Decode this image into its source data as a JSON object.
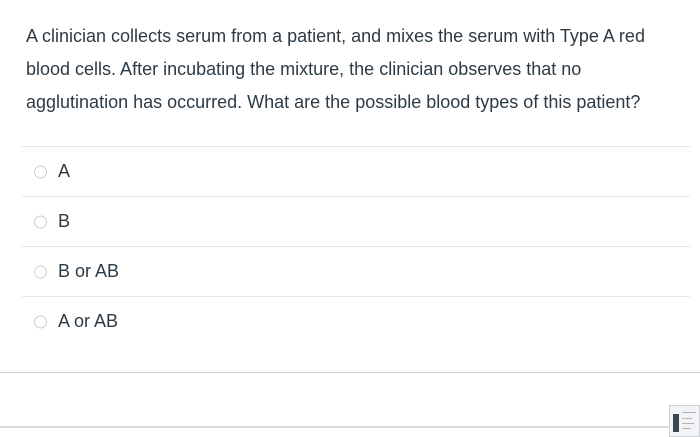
{
  "question": {
    "text": "A clinician collects serum from a patient, and mixes the serum with Type A red blood cells. After incubating the mixture, the clinician observes that no agglutination has occurred. What are the possible blood types of this patient?"
  },
  "answers": [
    {
      "label": "A",
      "selected": false
    },
    {
      "label": "B",
      "selected": false
    },
    {
      "label": "B or AB",
      "selected": false
    },
    {
      "label": "A or AB",
      "selected": false
    }
  ],
  "colors": {
    "text": "#2d3b45",
    "divider": "#e4e6e8",
    "radio_border": "#c7cdd1"
  }
}
